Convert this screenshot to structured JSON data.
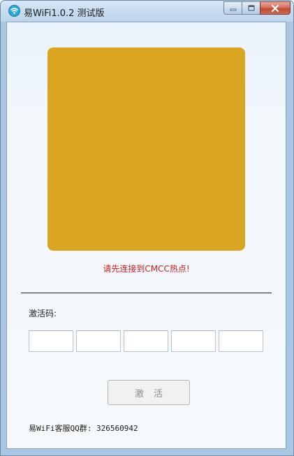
{
  "window": {
    "title": "易WiFi1.0.2 测试版",
    "icon": "wifi-app-icon"
  },
  "caption_buttons": {
    "minimize_icon": "minimize-icon",
    "maximize_icon": "maximize-icon",
    "close_icon": "close-icon"
  },
  "qr": {
    "color": "#daa520"
  },
  "status": {
    "message": "请先连接到CMCC热点!",
    "color": "#c81e1e"
  },
  "activation": {
    "label": "激活码:",
    "fields": [
      {
        "value": "",
        "placeholder": ""
      },
      {
        "value": "",
        "placeholder": ""
      },
      {
        "value": "",
        "placeholder": ""
      },
      {
        "value": "",
        "placeholder": ""
      },
      {
        "value": "",
        "placeholder": ""
      }
    ],
    "button_label": "激活",
    "button_state": "disabled"
  },
  "footer": {
    "support_label": "易WiFi客服QQ群:",
    "support_value": "326560942"
  }
}
